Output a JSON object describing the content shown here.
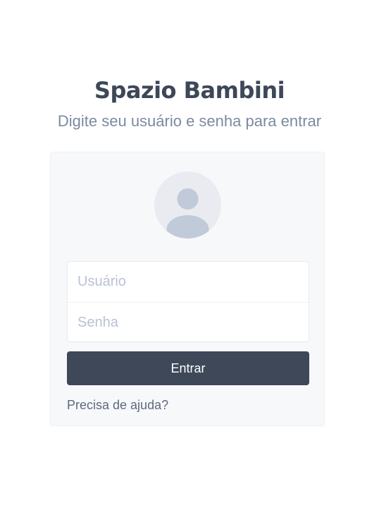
{
  "app": {
    "title": "Spazio Bambini",
    "subtitle": "Digite seu usuário e senha para entrar"
  },
  "login": {
    "avatar_icon": "user-icon",
    "username_placeholder": "Usuário",
    "username_value": "",
    "password_placeholder": "Senha",
    "password_value": "",
    "submit_label": "Entrar",
    "help_link": "Precisa de ajuda?"
  },
  "colors": {
    "primary": "#3e4859",
    "title": "#3d4757",
    "subtitle": "#7c8aa1",
    "card_background": "#f7f8fa",
    "placeholder": "#b9c3d3"
  }
}
